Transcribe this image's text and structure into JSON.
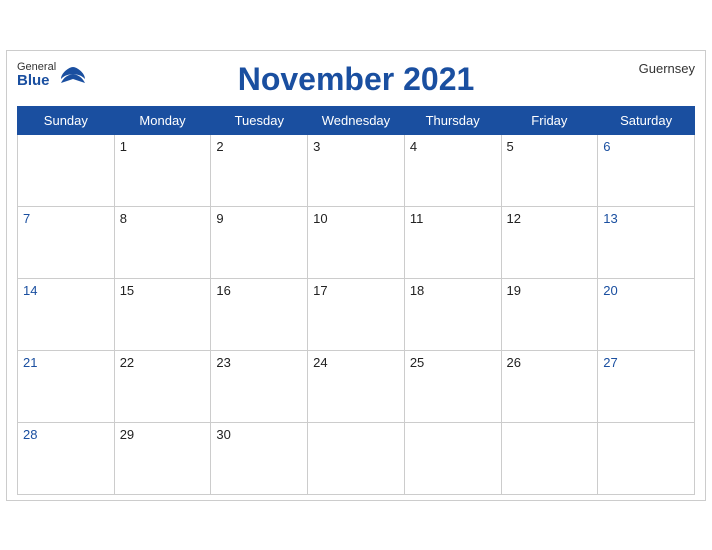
{
  "header": {
    "logo_general": "General",
    "logo_blue": "Blue",
    "title": "November 2021",
    "region": "Guernsey"
  },
  "weekdays": [
    "Sunday",
    "Monday",
    "Tuesday",
    "Wednesday",
    "Thursday",
    "Friday",
    "Saturday"
  ],
  "weeks": [
    [
      null,
      1,
      2,
      3,
      4,
      5,
      6
    ],
    [
      7,
      8,
      9,
      10,
      11,
      12,
      13
    ],
    [
      14,
      15,
      16,
      17,
      18,
      19,
      20
    ],
    [
      21,
      22,
      23,
      24,
      25,
      26,
      27
    ],
    [
      28,
      29,
      30,
      null,
      null,
      null,
      null
    ]
  ]
}
